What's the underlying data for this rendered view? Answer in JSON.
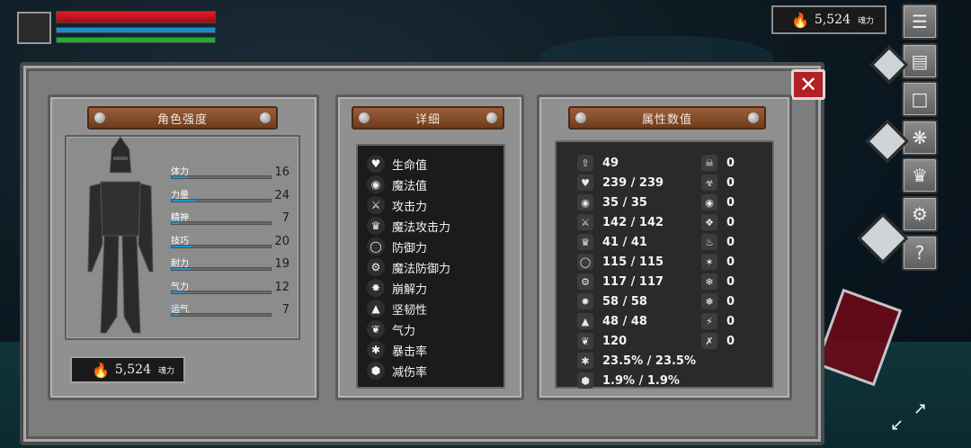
{
  "hud": {
    "currency_amount": "5,524",
    "currency_unit": "魂力"
  },
  "panel": {
    "left_title": "角色强度",
    "mid_title": "详细",
    "right_title": "属性数值"
  },
  "stats": [
    {
      "label": "体力",
      "value": "16",
      "fill": 0.16
    },
    {
      "label": "力量",
      "value": "24",
      "fill": 0.24
    },
    {
      "label": "精神",
      "value": "7",
      "fill": 0.07
    },
    {
      "label": "技巧",
      "value": "20",
      "fill": 0.2
    },
    {
      "label": "耐力",
      "value": "19",
      "fill": 0.19
    },
    {
      "label": "气力",
      "value": "12",
      "fill": 0.12
    },
    {
      "label": "运气",
      "value": "7",
      "fill": 0.07
    }
  ],
  "soul": {
    "amount": "5,524",
    "unit": "魂力"
  },
  "details": [
    {
      "label": "生命值",
      "icon": "heart-icon"
    },
    {
      "label": "魔法值",
      "icon": "brain-icon"
    },
    {
      "label": "攻击力",
      "icon": "sword-icon"
    },
    {
      "label": "魔法攻击力",
      "icon": "crown-icon"
    },
    {
      "label": "防御力",
      "icon": "shield-icon"
    },
    {
      "label": "魔法防御力",
      "icon": "gear-shield-icon"
    },
    {
      "label": "崩解力",
      "icon": "burst-icon"
    },
    {
      "label": "坚韧性",
      "icon": "helmet-icon"
    },
    {
      "label": "气力",
      "icon": "lungs-icon"
    },
    {
      "label": "暴击率",
      "icon": "star-icon"
    },
    {
      "label": "减伤率",
      "icon": "hex-shield-icon"
    }
  ],
  "attributes_left": [
    {
      "value": "49",
      "icon": "tower-icon"
    },
    {
      "value": "239 / 239",
      "icon": "heart-icon"
    },
    {
      "value": "35 / 35",
      "icon": "brain-icon"
    },
    {
      "value": "142 / 142",
      "icon": "sword-icon"
    },
    {
      "value": "41 / 41",
      "icon": "crown-icon"
    },
    {
      "value": "115 / 115",
      "icon": "shield-icon"
    },
    {
      "value": "117 / 117",
      "icon": "gear-shield-icon"
    },
    {
      "value": "58 / 58",
      "icon": "burst-icon"
    },
    {
      "value": "48 / 48",
      "icon": "helmet-icon"
    },
    {
      "value": "120",
      "icon": "lungs-icon"
    },
    {
      "value": "23.5% / 23.5%",
      "icon": "star-icon"
    },
    {
      "value": "1.9% / 1.9%",
      "icon": "hex-shield-icon"
    }
  ],
  "attributes_right": [
    {
      "value": "0",
      "icon": "skull-icon"
    },
    {
      "value": "0",
      "icon": "poison-icon"
    },
    {
      "value": "0",
      "icon": "drop-icon"
    },
    {
      "value": "0",
      "icon": "bleed-icon"
    },
    {
      "value": "0",
      "icon": "fire-icon"
    },
    {
      "value": "0",
      "icon": "fire-burst-icon"
    },
    {
      "value": "0",
      "icon": "frost-icon"
    },
    {
      "value": "0",
      "icon": "ice-icon"
    },
    {
      "value": "0",
      "icon": "lightning-icon"
    },
    {
      "value": "0",
      "icon": "curse-icon"
    }
  ]
}
